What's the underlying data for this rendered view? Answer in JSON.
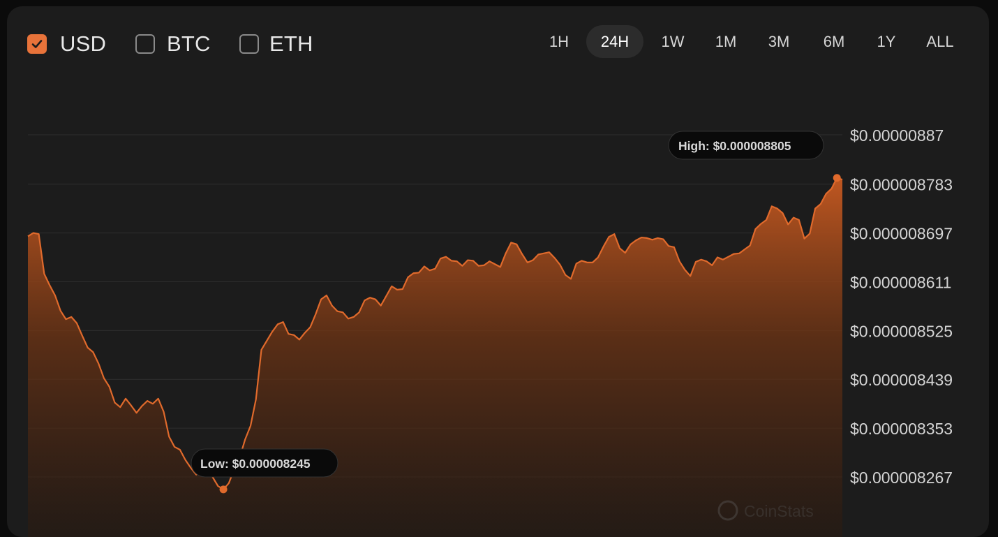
{
  "currencies": [
    {
      "label": "USD",
      "checked": true
    },
    {
      "label": "BTC",
      "checked": false
    },
    {
      "label": "ETH",
      "checked": false
    }
  ],
  "timeframes": [
    {
      "label": "1H",
      "active": false
    },
    {
      "label": "24H",
      "active": true
    },
    {
      "label": "1W",
      "active": false
    },
    {
      "label": "1M",
      "active": false
    },
    {
      "label": "3M",
      "active": false
    },
    {
      "label": "6M",
      "active": false
    },
    {
      "label": "1Y",
      "active": false
    },
    {
      "label": "ALL",
      "active": false
    }
  ],
  "colors": {
    "accent": "#e8733a",
    "line": "#e06a2c",
    "background": "#1c1c1c",
    "grid": "#2e2e2e"
  },
  "watermark": "CoinStats",
  "chart_data": {
    "type": "area",
    "title": "",
    "xlabel": "",
    "ylabel": "",
    "ylim": [
      8.224e-06,
      8.908e-06
    ],
    "y_ticks": [
      8.87e-06,
      8.783e-06,
      8.697e-06,
      8.611e-06,
      8.525e-06,
      8.439e-06,
      8.353e-06,
      8.267e-06
    ],
    "y_tick_labels": [
      "$0.00000887",
      "$0.000008783",
      "$0.000008697",
      "$0.000008611",
      "$0.000008525",
      "$0.000008439",
      "$0.000008353",
      "$0.000008267"
    ],
    "high_label": "High: $0.000008805",
    "low_label": "Low: $0.000008245",
    "high": 8.805e-06,
    "low": 8.245e-06,
    "values": [
      8.691e-06,
      8.697e-06,
      8.695e-06,
      8.625e-06,
      8.605e-06,
      8.587e-06,
      8.56e-06,
      8.545e-06,
      8.549e-06,
      8.538e-06,
      8.516e-06,
      8.495e-06,
      8.487e-06,
      8.467e-06,
      8.441e-06,
      8.426e-06,
      8.398e-06,
      8.39e-06,
      8.405e-06,
      8.393e-06,
      8.38e-06,
      8.392e-06,
      8.401e-06,
      8.396e-06,
      8.405e-06,
      8.382e-06,
      8.338e-06,
      8.32e-06,
      8.315e-06,
      8.297e-06,
      8.283e-06,
      8.271e-06,
      8.277e-06,
      8.281e-06,
      8.267e-06,
      8.251e-06,
      8.245e-06,
      8.256e-06,
      8.281e-06,
      8.301e-06,
      8.333e-06,
      8.357e-06,
      8.404e-06,
      8.491e-06,
      8.507e-06,
      8.523e-06,
      8.536e-06,
      8.54e-06,
      8.519e-06,
      8.517e-06,
      8.509e-06,
      8.521e-06,
      8.531e-06,
      8.554e-06,
      8.58e-06,
      8.587e-06,
      8.569e-06,
      8.559e-06,
      8.557e-06,
      8.546e-06,
      8.549e-06,
      8.557e-06,
      8.578e-06,
      8.583e-06,
      8.58e-06,
      8.569e-06,
      8.586e-06,
      8.603e-06,
      8.597e-06,
      8.598e-06,
      8.619e-06,
      8.626e-06,
      8.627e-06,
      8.638e-06,
      8.631e-06,
      8.634e-06,
      8.652e-06,
      8.655e-06,
      8.648e-06,
      8.647e-06,
      8.639e-06,
      8.649e-06,
      8.648e-06,
      8.639e-06,
      8.64e-06,
      8.647e-06,
      8.642e-06,
      8.637e-06,
      8.661e-06,
      8.68e-06,
      8.677e-06,
      8.66e-06,
      8.645e-06,
      8.649e-06,
      8.659e-06,
      8.661e-06,
      8.663e-06,
      8.653e-06,
      8.641e-06,
      8.623e-06,
      8.616e-06,
      8.643e-06,
      8.648e-06,
      8.645e-06,
      8.645e-06,
      8.654e-06,
      8.673e-06,
      8.69e-06,
      8.695e-06,
      8.67e-06,
      8.662e-06,
      8.677e-06,
      8.684e-06,
      8.689e-06,
      8.688e-06,
      8.685e-06,
      8.688e-06,
      8.686e-06,
      8.674e-06,
      8.672e-06,
      8.647e-06,
      8.632e-06,
      8.621e-06,
      8.646e-06,
      8.65e-06,
      8.647e-06,
      8.64e-06,
      8.654e-06,
      8.65e-06,
      8.655e-06,
      8.66e-06,
      8.661e-06,
      8.668e-06,
      8.675e-06,
      8.704e-06,
      8.713e-06,
      8.72e-06,
      8.744e-06,
      8.74e-06,
      8.732e-06,
      8.712e-06,
      8.724e-06,
      8.72e-06,
      8.687e-06,
      8.696e-06,
      8.74e-06,
      8.748e-06,
      8.766e-06,
      8.775e-06,
      8.794e-06,
      8.791e-06
    ]
  }
}
